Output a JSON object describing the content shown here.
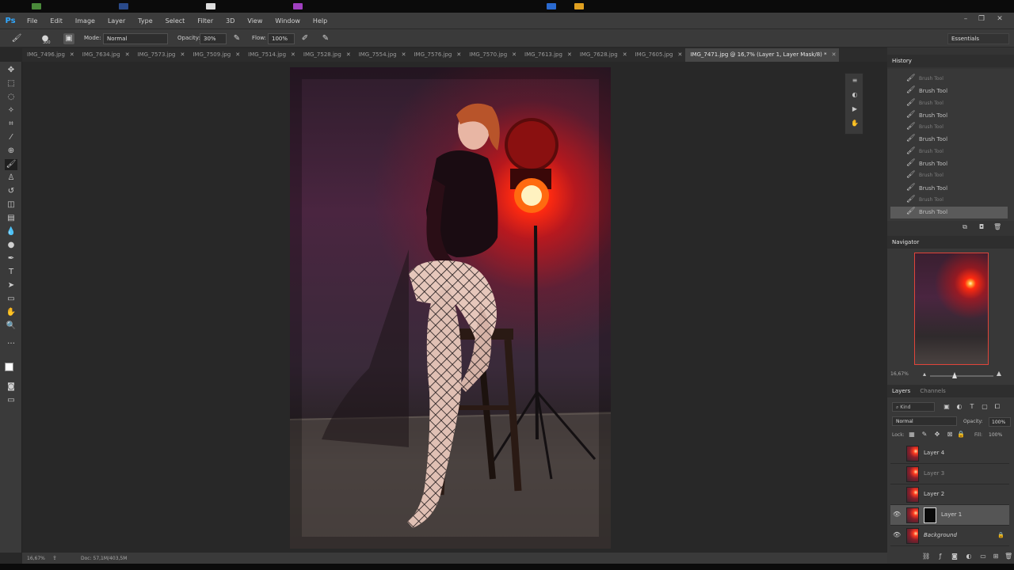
{
  "app": {
    "logo": "Ps",
    "menu": [
      "File",
      "Edit",
      "Image",
      "Layer",
      "Type",
      "Select",
      "Filter",
      "3D",
      "View",
      "Window",
      "Help"
    ],
    "workspace": "Essentials"
  },
  "options_bar": {
    "mode_label": "Mode:",
    "mode_value": "Normal",
    "opacity_label": "Opacity:",
    "opacity_value": "30%",
    "flow_label": "Flow:",
    "flow_value": "100%",
    "brush_size": "300"
  },
  "tabs": [
    {
      "label": "IMG_7496.jpg",
      "active": false
    },
    {
      "label": "IMG_7634.jpg",
      "active": false
    },
    {
      "label": "IMG_7573.jpg",
      "active": false
    },
    {
      "label": "IMG_7509.jpg",
      "active": false
    },
    {
      "label": "IMG_7514.jpg",
      "active": false
    },
    {
      "label": "IMG_7528.jpg",
      "active": false
    },
    {
      "label": "IMG_7554.jpg",
      "active": false
    },
    {
      "label": "IMG_7576.jpg",
      "active": false
    },
    {
      "label": "IMG_7570.jpg",
      "active": false
    },
    {
      "label": "IMG_7613.jpg",
      "active": false
    },
    {
      "label": "IMG_7628.jpg",
      "active": false
    },
    {
      "label": "IMG_7605.jpg",
      "active": false
    },
    {
      "label": "IMG_7471.jpg @ 16,7% (Layer 1, Layer Mask/8) *",
      "active": true
    }
  ],
  "history": {
    "title": "History",
    "items": [
      {
        "label": "Brush Tool",
        "dim": true
      },
      {
        "label": "Brush Tool",
        "dim": false
      },
      {
        "label": "Brush Tool",
        "dim": true
      },
      {
        "label": "Brush Tool",
        "dim": false
      },
      {
        "label": "Brush Tool",
        "dim": true
      },
      {
        "label": "Brush Tool",
        "dim": false
      },
      {
        "label": "Brush Tool",
        "dim": true
      },
      {
        "label": "Brush Tool",
        "dim": false
      },
      {
        "label": "Brush Tool",
        "dim": true
      },
      {
        "label": "Brush Tool",
        "dim": false
      },
      {
        "label": "Brush Tool",
        "dim": true
      },
      {
        "label": "Brush Tool",
        "dim": false
      }
    ]
  },
  "navigator": {
    "title": "Navigator",
    "zoom": "16,67%"
  },
  "layers_panel": {
    "tabs": [
      "Layers",
      "Channels"
    ],
    "filter": "Kind",
    "blend_mode": "Normal",
    "opacity_label": "Opacity:",
    "opacity_value": "100%",
    "lock_label": "Lock:",
    "fill_label": "Fill:",
    "fill_value": "100%",
    "layers": [
      {
        "name": "Layer 4",
        "visible": false,
        "mask": false,
        "selected": false
      },
      {
        "name": "Layer 3",
        "visible": false,
        "mask": false,
        "selected": false
      },
      {
        "name": "Layer 2",
        "visible": false,
        "mask": false,
        "selected": false
      },
      {
        "name": "Layer 1",
        "visible": true,
        "mask": true,
        "selected": true
      },
      {
        "name": "Background",
        "visible": true,
        "mask": false,
        "selected": false,
        "locked": true
      }
    ]
  },
  "status": {
    "zoom": "16,67%",
    "doc": "Doc: 57,1M/403,5M"
  },
  "colors": {
    "accent": "#31a8ff",
    "nav_frame": "#e0443a"
  }
}
